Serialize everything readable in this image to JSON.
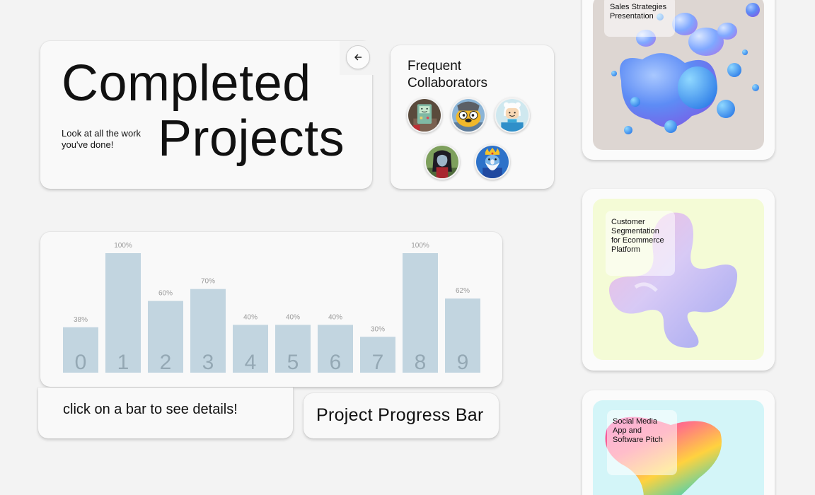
{
  "header": {
    "title_line1": "Completed",
    "title_line2": "Projects",
    "subtitle": "Look at all the work you've done!"
  },
  "collaborators": {
    "title": "Frequent Collaborators",
    "avatars": [
      "bmo",
      "jake",
      "finn",
      "marceline",
      "ice-king"
    ]
  },
  "chart_data": {
    "type": "bar",
    "categories": [
      "0",
      "1",
      "2",
      "3",
      "4",
      "5",
      "6",
      "7",
      "8",
      "9"
    ],
    "values": [
      38,
      100,
      60,
      70,
      40,
      40,
      40,
      30,
      100,
      62
    ],
    "value_labels": [
      "38%",
      "100%",
      "60%",
      "70%",
      "40%",
      "40%",
      "40%",
      "30%",
      "100%",
      "62%"
    ],
    "ylim": [
      0,
      100
    ],
    "bar_color": "#c2d5e0",
    "grid": false
  },
  "chart_hint": "click on a bar to see details!",
  "chart_title": "Project Progress Bar",
  "projects": [
    {
      "label": "Sales Strategies Presentation",
      "bg": "#ddd6d2"
    },
    {
      "label": "Customer Segmentation for Ecommerce Platform",
      "bg": "#f4fbd6"
    },
    {
      "label": "Social Media App and Software Pitch",
      "bg": "#d3f5f8"
    }
  ],
  "colors": {
    "background": "#f3f3f3",
    "card": "#f9f9f9",
    "bar": "#c2d5e0",
    "bar_number": "#94a8b4"
  }
}
